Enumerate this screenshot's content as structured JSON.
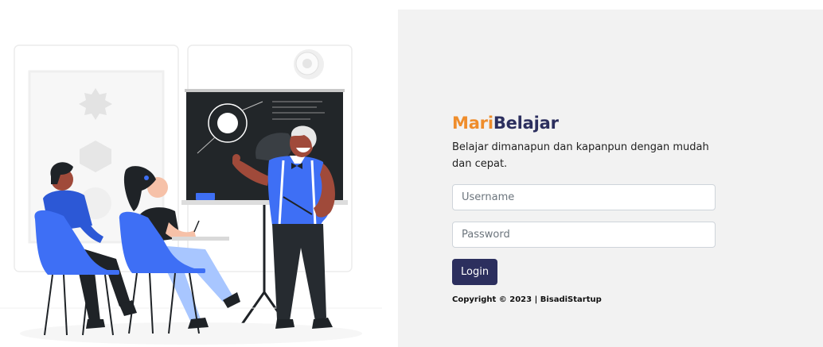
{
  "brand": {
    "part1": "Mari",
    "part2": "Belajar"
  },
  "tagline": "Belajar dimanapun dan kapanpun dengan mudah dan cepat.",
  "login_form": {
    "username_placeholder": "Username",
    "username_value": "",
    "password_placeholder": "Password",
    "password_value": "",
    "login_label": "Login"
  },
  "copyright": "Copyright © 2023 | BisadiStartup",
  "colors": {
    "brand_orange": "#ef8d2c",
    "brand_navy": "#2c2f5e",
    "illustration_accent": "#3e6ff5",
    "panel_background": "#f2f2f2"
  },
  "illustration": {
    "icon": "classroom-presentation-illustration"
  }
}
